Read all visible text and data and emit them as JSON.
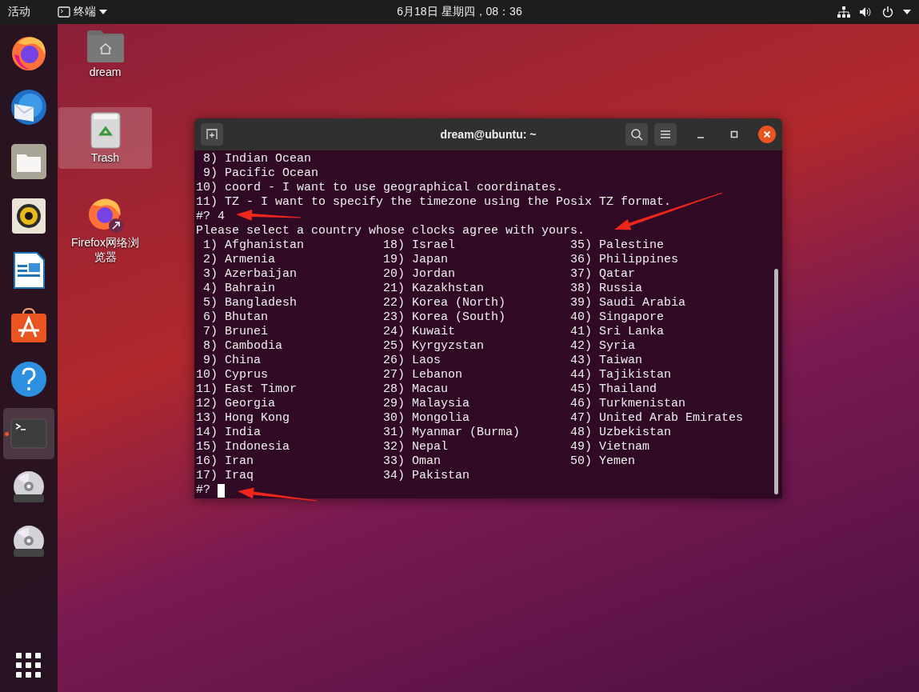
{
  "top_bar": {
    "activities": "活动",
    "app_menu": "终端",
    "clock": "6月18日 星期四，08：36"
  },
  "dock": {
    "items": [
      {
        "selected": false,
        "running": false
      },
      {
        "selected": false,
        "running": false
      },
      {
        "selected": false,
        "running": false
      },
      {
        "selected": false,
        "running": false
      },
      {
        "selected": false,
        "running": false
      },
      {
        "selected": false,
        "running": false
      },
      {
        "selected": false,
        "running": false
      },
      {
        "selected": true,
        "running": true
      },
      {
        "selected": false,
        "running": false
      },
      {
        "selected": false,
        "running": false
      }
    ]
  },
  "desktop_icons": [
    {
      "label": "dream",
      "selected": false
    },
    {
      "label": "Trash",
      "selected": true
    },
    {
      "label": "Firefox网络浏览器",
      "selected": false
    }
  ],
  "terminal": {
    "title": "dream@ubuntu: ~",
    "lines": [
      " 8) Indian Ocean",
      " 9) Pacific Ocean",
      "10) coord - I want to use geographical coordinates.",
      "11) TZ - I want to specify the timezone using the Posix TZ format.",
      "#? 4",
      "Please select a country whose clocks agree with yours."
    ],
    "countries": [
      " 1) Afghanistan",
      " 2) Armenia",
      " 3) Azerbaijan",
      " 4) Bahrain",
      " 5) Bangladesh",
      " 6) Bhutan",
      " 7) Brunei",
      " 8) Cambodia",
      " 9) China",
      "10) Cyprus",
      "11) East Timor",
      "12) Georgia",
      "13) Hong Kong",
      "14) India",
      "15) Indonesia",
      "16) Iran",
      "17) Iraq",
      "18) Israel",
      "19) Japan",
      "20) Jordan",
      "21) Kazakhstan",
      "22) Korea (North)",
      "23) Korea (South)",
      "24) Kuwait",
      "25) Kyrgyzstan",
      "26) Laos",
      "27) Lebanon",
      "28) Macau",
      "29) Malaysia",
      "30) Mongolia",
      "31) Myanmar (Burma)",
      "32) Nepal",
      "33) Oman",
      "34) Pakistan",
      "35) Palestine",
      "36) Philippines",
      "37) Qatar",
      "38) Russia",
      "39) Saudi Arabia",
      "40) Singapore",
      "41) Sri Lanka",
      "42) Syria",
      "43) Taiwan",
      "44) Tajikistan",
      "45) Thailand",
      "46) Turkmenistan",
      "47) United Arab Emirates",
      "48) Uzbekistan",
      "49) Vietnam",
      "50) Yemen"
    ],
    "prompt": "#?"
  }
}
